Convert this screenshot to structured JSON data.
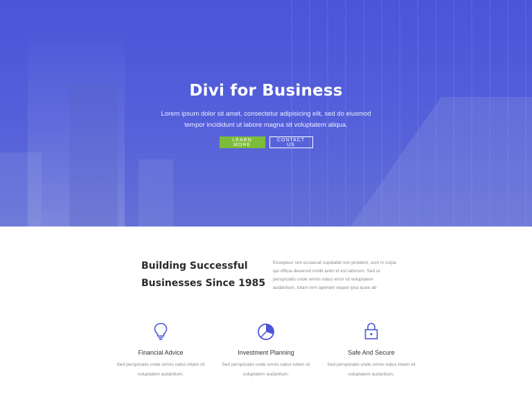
{
  "hero": {
    "title": "Divi for Business",
    "subtitle": "Lorem ipsum dolor sit amet, consectetur adipisicing elit, sed do eiusmod tempor incididunt ut labore magna sit voluptatem aliqua.",
    "learn_more_label": "LEARN MORE",
    "contact_label": "CONTACT US",
    "accent_color": "#7dbb3a",
    "background_color": "#4f5bd9"
  },
  "intro": {
    "heading_line1": "Building Successful",
    "heading_line2_prefix": "Businesses Since ",
    "heading_year": "1985",
    "text": "Excepteur sint occaecat cupidatat non proident, sunt in culpa qui officia deserunt mollit anim id est laborum. Sed ut perspiciatis unde omnis natus error sit voluptatem audantium, totam rem aperiam eaque ipsa quae ab"
  },
  "features": [
    {
      "icon": "lightbulb-icon",
      "title": "Financial Advice",
      "text": "Sed perspiciatis unde omnis natus totam sit voluptatem audantium."
    },
    {
      "icon": "pie-chart-icon",
      "title": "Investment Planning",
      "text": "Sed perspiciatis unde omnis natus totam sit voluptatem audantium."
    },
    {
      "icon": "lock-icon",
      "title": "Safe And Secure",
      "text": "Sed perspiciatis unde omnis natus totam sit voluptatem audantium."
    }
  ],
  "icon_color": "#4a55d8"
}
